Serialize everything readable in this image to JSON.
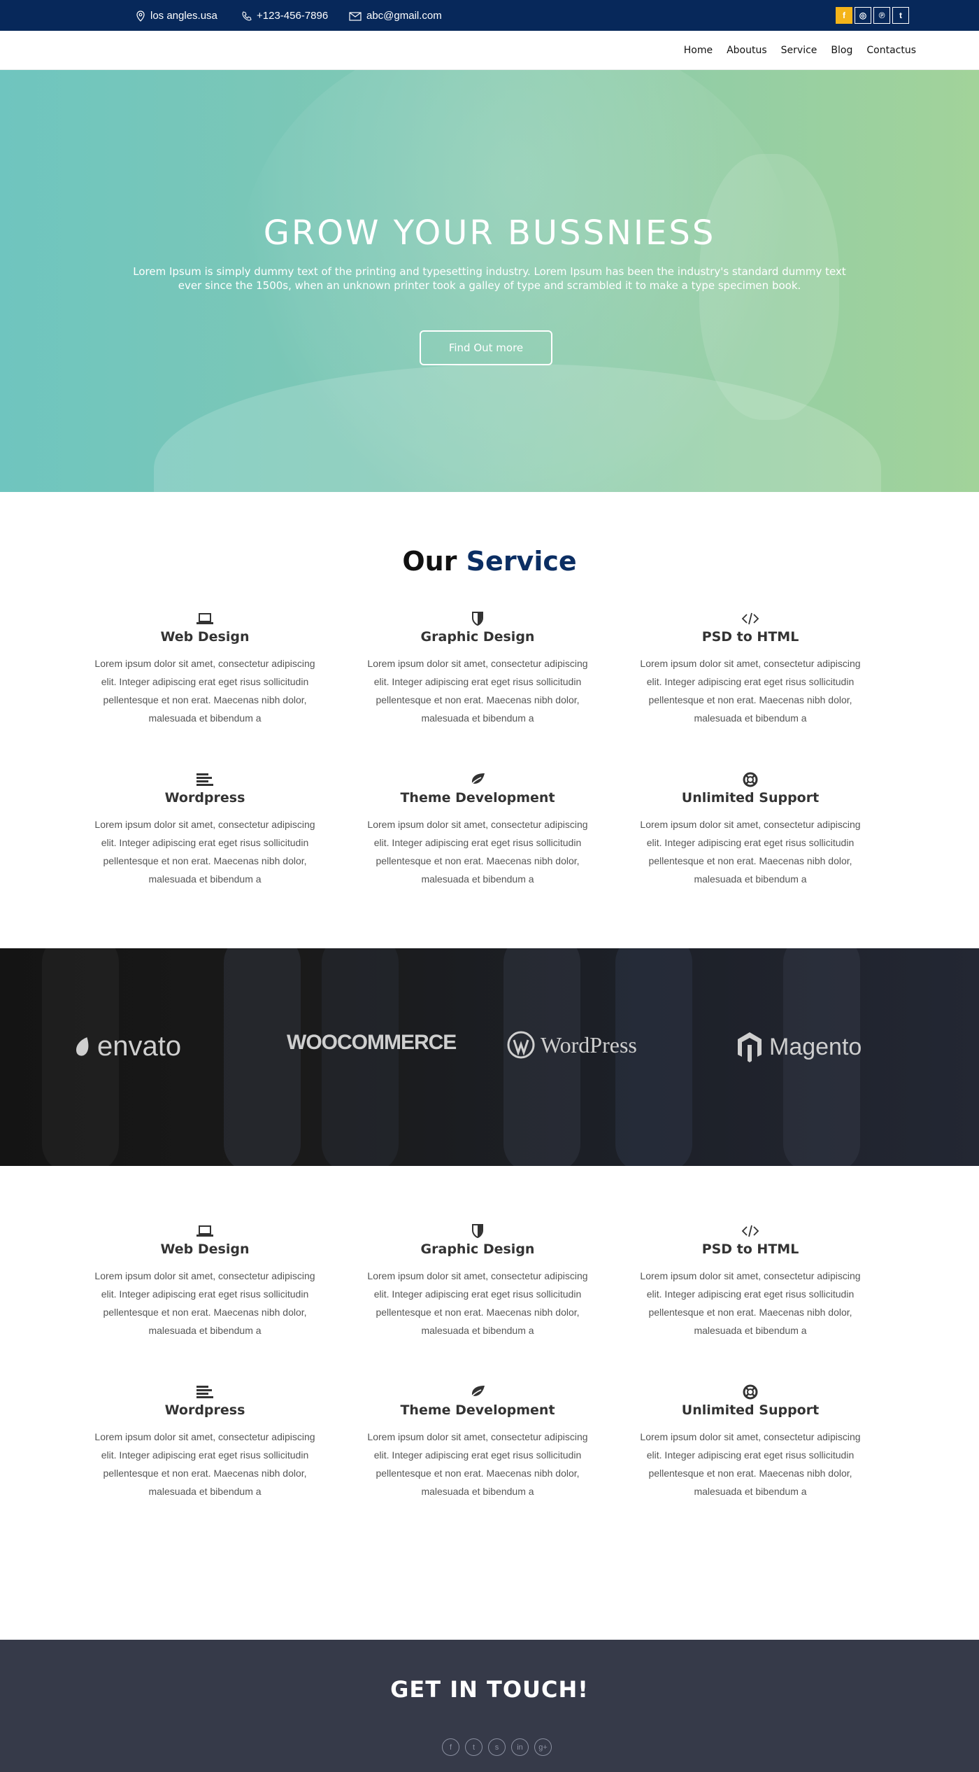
{
  "topbar": {
    "location": "los angles.usa",
    "phone": "+123-456-7896",
    "email": "abc@gmail.com",
    "social": [
      "f",
      "◎",
      "℗",
      "t"
    ]
  },
  "nav": {
    "items": [
      "Home",
      "Aboutus",
      "Service",
      "Blog",
      "Contactus"
    ]
  },
  "hero": {
    "title": "GROW YOUR BUSSNIESS",
    "text": "Lorem Ipsum is simply dummy text of the printing and typesetting industry. Lorem Ipsum has been the industry's standard dummy text ever since the 1500s, when an unknown printer took a galley of type and scrambled it to make a type specimen book.",
    "button": "Find Out more"
  },
  "services_title": {
    "part1": "Our",
    "part2": "Service"
  },
  "services": [
    {
      "icon": "laptop-icon",
      "title": "Web Design",
      "text": "Lorem ipsum dolor sit amet, consectetur adipiscing elit. Integer adipiscing erat eget risus sollicitudin pellentesque et non erat. Maecenas nibh dolor, malesuada et bibendum a"
    },
    {
      "icon": "shield-icon",
      "title": "Graphic Design",
      "text": "Lorem ipsum dolor sit amet, consectetur adipiscing elit. Integer adipiscing erat eget risus sollicitudin pellentesque et non erat. Maecenas nibh dolor, malesuada et bibendum a"
    },
    {
      "icon": "code-icon",
      "title": "PSD to HTML",
      "text": "Lorem ipsum dolor sit amet, consectetur adipiscing elit. Integer adipiscing erat eget risus sollicitudin pellentesque et non erat. Maecenas nibh dolor, malesuada et bibendum a"
    },
    {
      "icon": "align-left-icon",
      "title": "Wordpress",
      "text": "Lorem ipsum dolor sit amet, consectetur adipiscing elit. Integer adipiscing erat eget risus sollicitudin pellentesque et non erat. Maecenas nibh dolor, malesuada et bibendum a"
    },
    {
      "icon": "leaf-icon",
      "title": "Theme Development",
      "text": "Lorem ipsum dolor sit amet, consectetur adipiscing elit. Integer adipiscing erat eget risus sollicitudin pellentesque et non erat. Maecenas nibh dolor, malesuada et bibendum a"
    },
    {
      "icon": "life-ring-icon",
      "title": "Unlimited Support",
      "text": "Lorem ipsum dolor sit amet, consectetur adipiscing elit. Integer adipiscing erat eget risus sollicitudin pellentesque et non erat. Maecenas nibh dolor, malesuada et bibendum a"
    }
  ],
  "partners": [
    "envato",
    "WOOCOMMERCE",
    "WordPress",
    "Magento"
  ],
  "footer": {
    "title": "GET IN TOUCH!",
    "social": [
      "f",
      "t",
      "s",
      "in",
      "g+"
    ]
  }
}
